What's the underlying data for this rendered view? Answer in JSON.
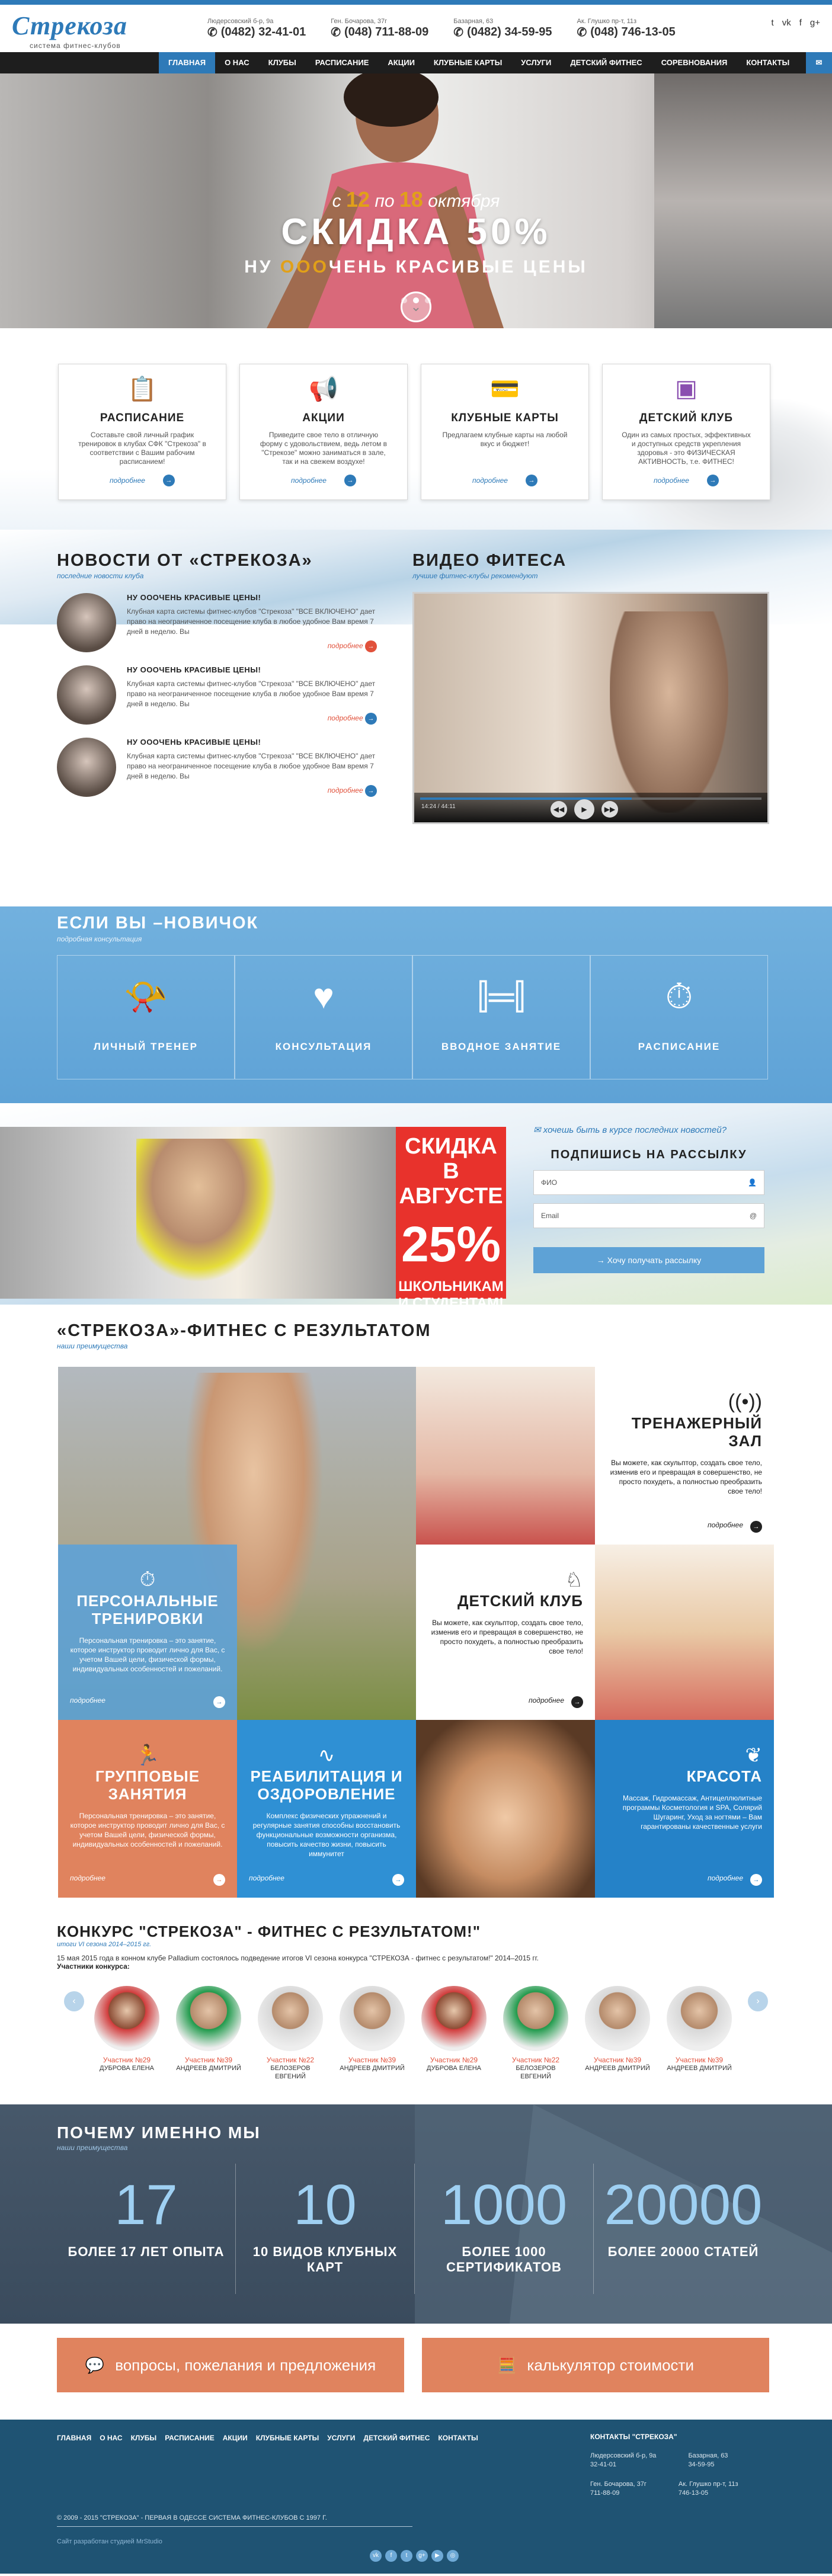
{
  "brand": {
    "logo": "Стрекоза",
    "subtitle": "система фитнес-клубов"
  },
  "contacts": [
    {
      "addr": "Людерсовский б-р, 9а",
      "phone": "(0482) 32-41-01"
    },
    {
      "addr": "Ген. Бочарова, 37г",
      "phone": "(048) 711-88-09"
    },
    {
      "addr": "Базарная, 63",
      "phone": "(0482) 34-59-95"
    },
    {
      "addr": "Ак. Глушко пр-т, 11з",
      "phone": "(048) 746-13-05"
    }
  ],
  "social": [
    "twitter-icon",
    "vk-icon",
    "facebook-icon",
    "gplus-icon"
  ],
  "nav": [
    "Главная",
    "О нас",
    "Клубы",
    "Расписание",
    "Акции",
    "Клубные карты",
    "Услуги",
    "Детский фитнес",
    "Соревнования",
    "Контакты"
  ],
  "hero": {
    "from_word": "с",
    "from_num": "12",
    "to_word": "по",
    "to_num": "18",
    "month": "октября",
    "headline": "СКИДКА 50%",
    "tag_pre": "НУ",
    "tag_hl": "ООО",
    "tag_post": "ЧЕНЬ КРАСИВЫЕ ЦЕНЫ"
  },
  "features": [
    {
      "title": "РАСПИСАНИЕ",
      "text": "Составьте свой личный график тренировок в клубах СФК \"Стрекоза\" в соответствии с Вашим рабочим расписанием!",
      "more": "подробнее"
    },
    {
      "title": "АКЦИИ",
      "text": "Приведите свое тело в отличную форму с удовольствием, ведь летом в \"Стрекозе\" можно заниматься в зале, так и на свежем воздухе!",
      "more": "подробнее"
    },
    {
      "title": "КЛУБНЫЕ КАРТЫ",
      "text": "Предлагаем клубные карты на любой вкус и бюджет!",
      "more": "подробнее"
    },
    {
      "title": "ДЕТСКИЙ КЛУБ",
      "text": "Один из самых простых, эффективных и доступных средств укрепления здоровья - это ФИЗИЧЕСКАЯ АКТИВНОСТЬ, т.е. ФИТНЕС!",
      "more": "подробнее"
    }
  ],
  "news": {
    "title": "НОВОСТИ ОТ «СТРЕКОЗА»",
    "sub": "последние новости клуба",
    "items": [
      {
        "title": "НУ ОООЧЕНЬ КРАСИВЫЕ ЦЕНЫ!",
        "text": "Клубная карта системы фитнес-клубов \"Стрекоза\" \"ВСЕ ВКЛЮЧЕНО\" дает право на неограниченное посещение клуба в любое удобное Вам время 7 дней в неделю. Вы",
        "more": "подробнее"
      },
      {
        "title": "НУ ОООЧЕНЬ КРАСИВЫЕ ЦЕНЫ!",
        "text": "Клубная карта системы фитнес-клубов \"Стрекоза\" \"ВСЕ ВКЛЮЧЕНО\" дает право на неограниченное посещение клуба в любое удобное Вам время 7 дней в неделю. Вы",
        "more": "подробнее"
      },
      {
        "title": "НУ ОООЧЕНЬ КРАСИВЫЕ ЦЕНЫ!",
        "text": "Клубная карта системы фитнес-клубов \"Стрекоза\" \"ВСЕ ВКЛЮЧЕНО\" дает право на неограниченное посещение клуба в любое удобное Вам время 7 дней в неделю. Вы",
        "more": "подробнее"
      }
    ]
  },
  "video": {
    "title": "ВИДЕО ФИТЕСА",
    "sub": "лучшие фитнес-клубы рекомендуют",
    "time": "14:24 / 44:11",
    "progress": 0.62
  },
  "newbie": {
    "title": "ЕСЛИ ВЫ –НОВИЧОК",
    "sub": "подробная консультация",
    "items": [
      "ЛИЧНЫЙ ТРЕНЕР",
      "КОНСУЛЬТАЦИЯ",
      "ВВОДНОЕ ЗАНЯТИЕ",
      "РАСПИСАНИЕ"
    ]
  },
  "promo": {
    "l1": "СКИДКА",
    "l2": "В АВГУСТЕ",
    "pct": "25%",
    "l3": "ШКОЛЬНИКАМ",
    "l4": "И СТУДЕНТАМ!"
  },
  "subscribe": {
    "question": "хочешь быть в курсе последних новостей?",
    "title": "ПОДПИШИСЬ НА РАССЫЛКУ",
    "name_ph": "ФИО",
    "email_ph": "Email",
    "button": "Хочу получать рассылку"
  },
  "results": {
    "title": "«СТРЕКОЗА»-ФИТНЕС С РЕЗУЛЬТАТОМ",
    "sub": "наши преимущества",
    "personal": {
      "title": "ПЕРСОНАЛЬНЫЕ ТРЕНИРОВКИ",
      "text": "Персональная тренировка – это занятие, которое инструктор проводит лично для Вас, с учетом Вашей цели, физической формы, индивидуальных особенностей и пожеланий.",
      "more": "подробнее"
    },
    "gym": {
      "title": "ТРЕНАЖЕРНЫЙ ЗАЛ",
      "text": "Вы можете, как скульптор, создать свое тело, изменив его и превращая в совершенство, не просто похудеть, а полностью преобразить свое тело!",
      "more": "подробнее"
    },
    "kids": {
      "title": "ДЕТСКИЙ КЛУБ",
      "text": "Вы можете, как скульптор, создать свое тело, изменив его и превращая в совершенство, не просто похудеть, а полностью преобразить свое тело!",
      "more": "подробнее"
    },
    "group": {
      "title": "ГРУППОВЫЕ ЗАНЯТИЯ",
      "text": "Персональная тренировка – это занятие, которое инструктор проводит лично для Вас, с учетом Вашей цели, физической формы, индивидуальных особенностей и пожеланий.",
      "more": "подробнее"
    },
    "rehab": {
      "title": "РЕАБИЛИТАЦИЯ И ОЗДОРОВЛЕНИЕ",
      "text": "Комплекс физических упражнений и регулярные занятия способны восстановить функциональные возможности организма, повысить качество жизни, повысить иммунитет",
      "more": "подробнее"
    },
    "beauty": {
      "title": "КРАСОТА",
      "text": "Массаж, Гидромассаж, Антицеллюлитные программы Косметология и SPA, Солярий Шугаринг, Уход за ногтями – Вам гарантированы качественные услуги",
      "more": "подробнее"
    }
  },
  "contest": {
    "title": "КОНКУРС \"СТРЕКОЗА\" - ФИТНЕС С РЕЗУЛЬТАТОМ!\"",
    "sub": "итоги VI сезона 2014–2015 гг.",
    "text": "15 мая 2015 года в конном клубе Palladium состоялось подведение итогов VI сезона конкурса \"СТРЕКОЗА - фитнес с результатом!\" 2014–2015 гг.",
    "label": "Участники конкурса:",
    "members": [
      {
        "num": "Участник №29",
        "name": "ДУБРОВА ЕЛЕНА",
        "ph": "r"
      },
      {
        "num": "Участник №39",
        "name": "АНДРЕЕВ ДМИТРИЙ",
        "ph": "g"
      },
      {
        "num": "Участник №22",
        "name": "БЕЛОЗЕРОВ ЕВГЕНИЙ",
        "ph": ""
      },
      {
        "num": "Участник №39",
        "name": "АНДРЕЕВ ДМИТРИЙ",
        "ph": ""
      },
      {
        "num": "Участник №29",
        "name": "ДУБРОВА ЕЛЕНА",
        "ph": "r"
      },
      {
        "num": "Участник №22",
        "name": "БЕЛОЗЕРОВ ЕВГЕНИЙ",
        "ph": "g"
      },
      {
        "num": "Участник №39",
        "name": "АНДРЕЕВ ДМИТРИЙ",
        "ph": ""
      },
      {
        "num": "Участник №39",
        "name": "АНДРЕЕВ ДМИТРИЙ",
        "ph": ""
      }
    ]
  },
  "why": {
    "title": "ПОЧЕМУ ИМЕННО МЫ",
    "sub": "наши преимущества",
    "stats": [
      {
        "num": "17",
        "cap": "БОЛЕЕ 17 ЛЕТ ОПЫТА"
      },
      {
        "num": "10",
        "cap": "10 ВИДОВ КЛУБНЫХ КАРТ"
      },
      {
        "num": "1000",
        "cap": "БОЛЕЕ 1000 СЕРТИФИКАТОВ"
      },
      {
        "num": "20000",
        "cap": "БОЛЕЕ 20000 СТАТЕЙ"
      }
    ]
  },
  "cta": {
    "left": "вопросы, пожелания и предложения",
    "right": "калькулятор стоимости"
  },
  "footer": {
    "nav": [
      "ГЛАВНАЯ",
      "О НАС",
      "КЛУБЫ",
      "РАСПИСАНИЕ",
      "АКЦИИ",
      "КЛУБНЫЕ КАРТЫ",
      "УСЛУГИ",
      "ДЕТСКИЙ ФИТНЕС",
      "КОНТАКТЫ"
    ],
    "contacts_title": "КОНТАКТЫ \"СТРЕКОЗА\"",
    "c1a": "Людерсовский б-р, 9а",
    "c1b": "32-41-01",
    "c2a": "Базарная, 63",
    "c2b": "34-59-95",
    "c3a": "Ген. Бочарова, 37г",
    "c3b": "711-88-09",
    "c4a": "Ак. Глушко пр-т, 11з",
    "c4b": "746-13-05",
    "copyright": "© 2009 - 2015 \"СТРЕКОЗА\" - ПЕРВАЯ В ОДЕССЕ СИСТЕМА ФИТНЕС-КЛУБОВ С 1997 Г.",
    "dev": "Сайт разработан студией MrStudio"
  },
  "colors": {
    "brand_blue": "#2e7ab8",
    "accent_orange": "#e0835e",
    "sale_red": "#e8322c",
    "footer_bg": "#1f5373"
  }
}
